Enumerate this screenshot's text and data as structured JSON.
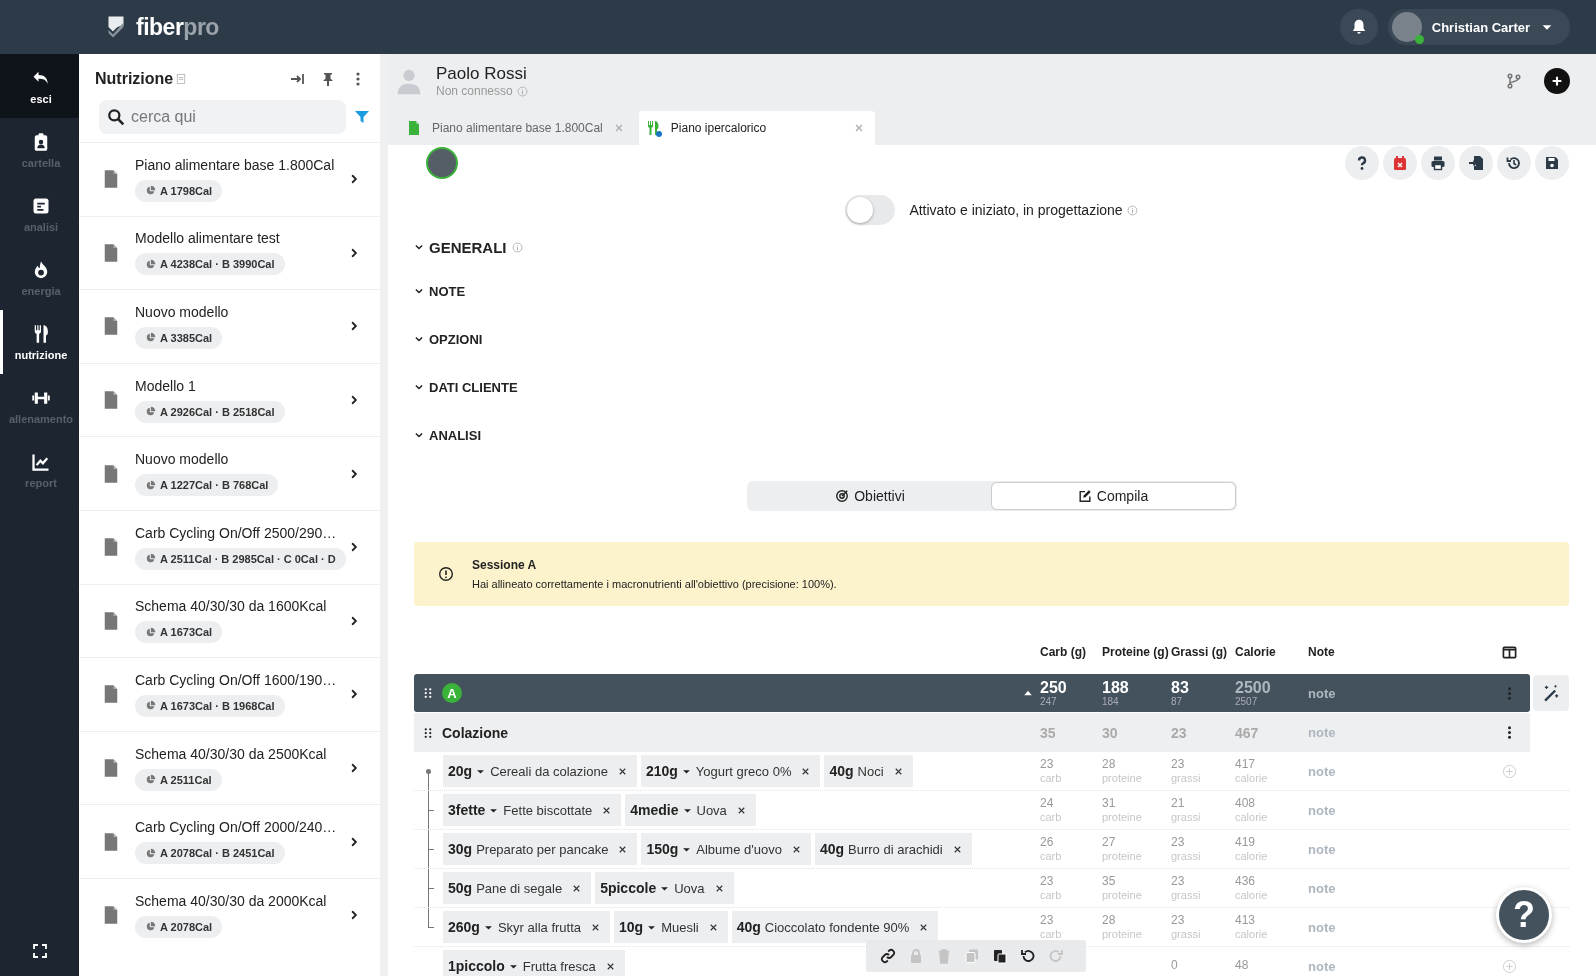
{
  "logo": {
    "main": "fiber",
    "accent": "pro"
  },
  "user": {
    "name": "Christian Carter",
    "online": true
  },
  "nav": [
    {
      "label": "esci",
      "kind": "back",
      "selected": false
    },
    {
      "label": "cartella",
      "kind": "folder",
      "selected": false
    },
    {
      "label": "analisi",
      "kind": "doc",
      "selected": false
    },
    {
      "label": "energia",
      "kind": "flame",
      "selected": false
    },
    {
      "label": "nutrizione",
      "kind": "fork",
      "selected": true
    },
    {
      "label": "allenamento",
      "kind": "dumbbell",
      "selected": false
    },
    {
      "label": "report",
      "kind": "chart",
      "selected": false
    }
  ],
  "panel": {
    "title": "Nutrizione",
    "search": {
      "placeholder": "cerca qui"
    },
    "items": [
      {
        "title": "Piano alimentare base 1.800Cal",
        "chip": "A 1798Cal"
      },
      {
        "title": "Modello alimentare test",
        "chip": "A 4238Cal · B 3990Cal"
      },
      {
        "title": "Nuovo modello",
        "chip": "A 3385Cal"
      },
      {
        "title": "Modello 1",
        "chip": "A 2926Cal · B 2518Cal"
      },
      {
        "title": "Nuovo modello",
        "chip": "A 1227Cal · B 768Cal"
      },
      {
        "title": "Carb Cycling On/Off 2500/290…",
        "chip": "A 2511Cal · B 2985Cal · C 0Cal · D"
      },
      {
        "title": "Schema 40/30/30 da 1600Kcal",
        "chip": "A 1673Cal"
      },
      {
        "title": "Carb Cycling On/Off 1600/190…",
        "chip": "A 1673Cal · B 1968Cal"
      },
      {
        "title": "Schema 40/30/30 da 2500Kcal",
        "chip": "A 2511Cal"
      },
      {
        "title": "Carb Cycling On/Off 2000/240…",
        "chip": "A 2078Cal · B 2451Cal"
      },
      {
        "title": "Schema 40/30/30 da 2000Kcal",
        "chip": "A 2078Cal"
      }
    ]
  },
  "client": {
    "name": "Paolo Rossi",
    "status": "Non connesso"
  },
  "tabs": [
    {
      "label": "Piano alimentare base 1.800Cal",
      "kind": "file",
      "selected": false
    },
    {
      "label": "Piano ipercalorico",
      "kind": "fork",
      "selected": true
    }
  ],
  "activation": {
    "on": false,
    "label": "Attivato e iniziato, in progettazione"
  },
  "sections": [
    {
      "label": "GENERALI",
      "info": true
    },
    {
      "label": "NOTE",
      "info": false
    },
    {
      "label": "OPZIONI",
      "info": false
    },
    {
      "label": "DATI CLIENTE",
      "info": false
    },
    {
      "label": "ANALISI",
      "info": false
    }
  ],
  "modes": [
    {
      "label": "Obiettivi",
      "kind": "target",
      "selected": false
    },
    {
      "label": "Compila",
      "kind": "edit",
      "selected": true
    }
  ],
  "alert": {
    "title": "Sessione A",
    "text": "Hai allineato correttamente i macronutrienti all'obiettivo (precisione: 100%)."
  },
  "table": {
    "columns": [
      "Carb (g)",
      "Proteine (g)",
      "Grassi (g)",
      "Calorie",
      "Note"
    ],
    "session": {
      "badge": "A",
      "carb": "250",
      "carb_target": "247",
      "protein": "188",
      "protein_target": "184",
      "fat": "83",
      "fat_target": "87",
      "calories": "2500",
      "calories_target": "2507",
      "note": "note"
    },
    "meal": {
      "name": "Colazione",
      "carb": "35",
      "protein": "30",
      "fat": "23",
      "calories": "467",
      "note": "note"
    },
    "rows": [
      {
        "linked": true,
        "addable": true,
        "items": [
          {
            "amount": "20g",
            "dropdown": true,
            "name": "Cereali da colazione"
          },
          {
            "amount": "210g",
            "dropdown": true,
            "name": "Yogurt greco 0%"
          },
          {
            "amount": "40g",
            "dropdown": false,
            "name": "Noci"
          }
        ],
        "values": [
          {
            "value": "23",
            "unit": "carb"
          },
          {
            "value": "28",
            "unit": "proteine"
          },
          {
            "value": "23",
            "unit": "grassi"
          },
          {
            "value": "417",
            "unit": "calorie"
          }
        ],
        "note": "note"
      },
      {
        "linked": true,
        "addable": false,
        "items": [
          {
            "amount": "3fette",
            "dropdown": true,
            "name": "Fette biscottate"
          },
          {
            "amount": "4medie",
            "dropdown": true,
            "name": "Uova"
          }
        ],
        "values": [
          {
            "value": "24",
            "unit": "carb"
          },
          {
            "value": "31",
            "unit": "proteine"
          },
          {
            "value": "21",
            "unit": "grassi"
          },
          {
            "value": "408",
            "unit": "calorie"
          }
        ],
        "note": "note"
      },
      {
        "linked": true,
        "addable": false,
        "items": [
          {
            "amount": "30g",
            "dropdown": false,
            "name": "Preparato per pancake"
          },
          {
            "amount": "150g",
            "dropdown": true,
            "name": "Albume d'uovo"
          },
          {
            "amount": "40g",
            "dropdown": false,
            "name": "Burro di arachidi"
          }
        ],
        "values": [
          {
            "value": "26",
            "unit": "carb"
          },
          {
            "value": "27",
            "unit": "proteine"
          },
          {
            "value": "23",
            "unit": "grassi"
          },
          {
            "value": "419",
            "unit": "calorie"
          }
        ],
        "note": "note"
      },
      {
        "linked": true,
        "addable": false,
        "items": [
          {
            "amount": "50g",
            "dropdown": false,
            "name": "Pane di segale"
          },
          {
            "amount": "5piccole",
            "dropdown": true,
            "name": "Uova"
          }
        ],
        "values": [
          {
            "value": "23",
            "unit": "carb"
          },
          {
            "value": "35",
            "unit": "proteine"
          },
          {
            "value": "23",
            "unit": "grassi"
          },
          {
            "value": "436",
            "unit": "calorie"
          }
        ],
        "note": "note"
      },
      {
        "linked": true,
        "addable": false,
        "items": [
          {
            "amount": "260g",
            "dropdown": true,
            "name": "Skyr alla frutta"
          },
          {
            "amount": "10g",
            "dropdown": true,
            "name": "Muesli"
          },
          {
            "amount": "40g",
            "dropdown": false,
            "name": "Cioccolato fondente 90%"
          }
        ],
        "values": [
          {
            "value": "23",
            "unit": "carb"
          },
          {
            "value": "28",
            "unit": "proteine"
          },
          {
            "value": "23",
            "unit": "grassi"
          },
          {
            "value": "413",
            "unit": "calorie"
          }
        ],
        "note": "note"
      },
      {
        "linked": false,
        "addable": true,
        "items": [
          {
            "amount": "1piccolo",
            "dropdown": true,
            "name": "Frutta fresca"
          }
        ],
        "values": {
          "fat": {
            "value": "0"
          },
          "calories": {
            "value": "48"
          }
        },
        "note": "note"
      }
    ]
  },
  "toolbar": [
    {
      "kind": "link",
      "disabled": false
    },
    {
      "kind": "lock",
      "disabled": true
    },
    {
      "kind": "trash",
      "disabled": true
    },
    {
      "kind": "copy",
      "disabled": true
    },
    {
      "kind": "paste",
      "disabled": false
    },
    {
      "kind": "undo",
      "disabled": false
    },
    {
      "kind": "redo",
      "disabled": true
    }
  ],
  "help": {
    "label": "?"
  }
}
